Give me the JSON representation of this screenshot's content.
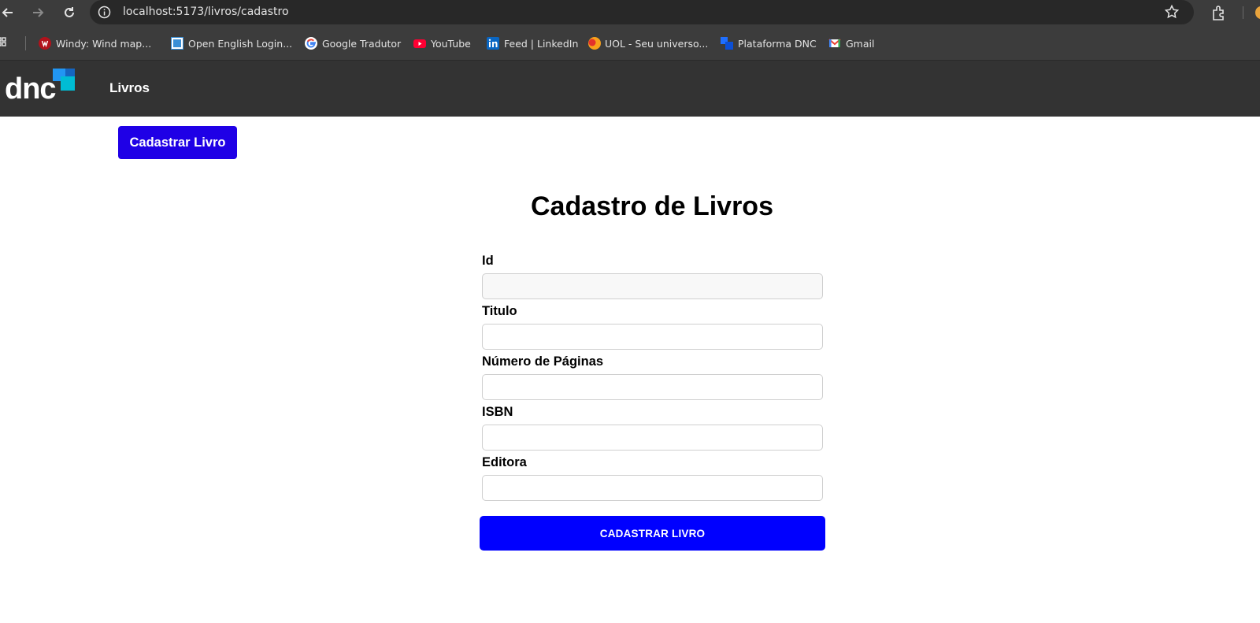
{
  "browser": {
    "url": "localhost:5173/livros/cadastro",
    "bookmarks": [
      {
        "label": "Windy: Wind map...",
        "icon": "windy-icon"
      },
      {
        "label": "Open English Login...",
        "icon": "open-english-icon"
      },
      {
        "label": "Google Tradutor",
        "icon": "google-icon"
      },
      {
        "label": "YouTube",
        "icon": "youtube-icon"
      },
      {
        "label": "Feed | LinkedIn",
        "icon": "linkedin-icon"
      },
      {
        "label": "UOL - Seu universo...",
        "icon": "uol-icon"
      },
      {
        "label": "Plataforma DNC",
        "icon": "dnc-icon"
      },
      {
        "label": "Gmail",
        "icon": "gmail-icon"
      }
    ]
  },
  "header": {
    "logo_text": "dnc",
    "nav_link": "Livros",
    "colors": {
      "background": "#333333"
    }
  },
  "page": {
    "top_button": "Cadastrar Livro",
    "title": "Cadastro de Livros",
    "fields": [
      {
        "label": "Id",
        "value": "",
        "placeholder": "",
        "disabled": true
      },
      {
        "label": "Titulo",
        "value": "",
        "placeholder": ""
      },
      {
        "label": "Número de Páginas",
        "value": "",
        "placeholder": ""
      },
      {
        "label": "ISBN",
        "value": "",
        "placeholder": ""
      },
      {
        "label": "Editora",
        "value": "",
        "placeholder": ""
      }
    ],
    "submit_button": "CADASTRAR LIVRO",
    "colors": {
      "top_button": "#1f00e6",
      "submit_button": "#0000ff"
    }
  }
}
